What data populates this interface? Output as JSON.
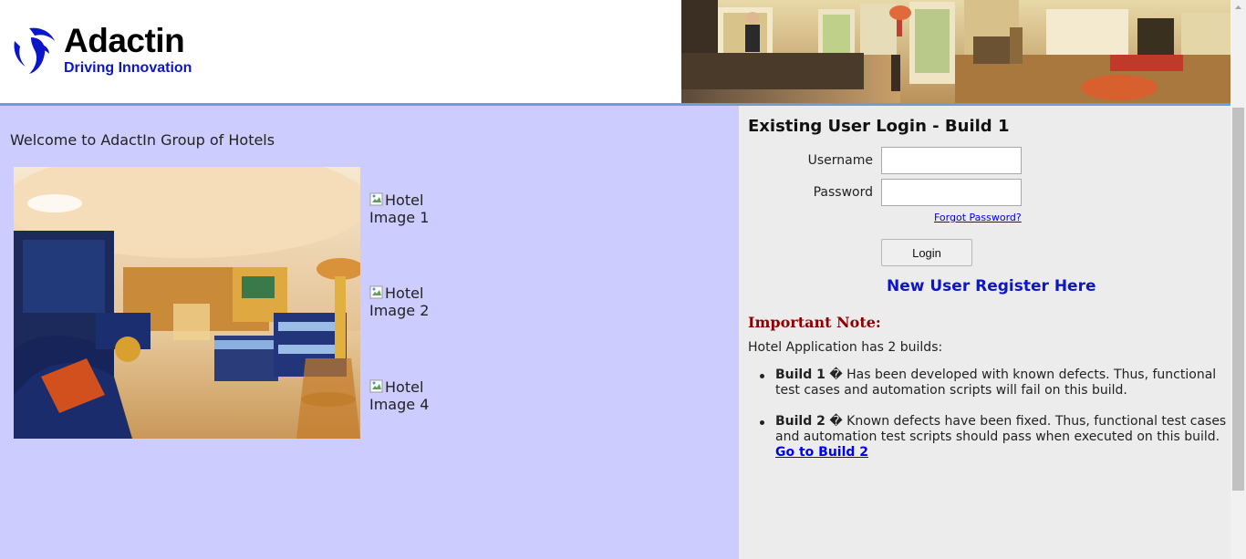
{
  "header": {
    "logo_name": "Adactin",
    "logo_tagline": "Driving Innovation"
  },
  "welcome": {
    "text": "Welcome to AdactIn Group of Hotels"
  },
  "hotel_images": [
    {
      "label": "Hotel Image 1"
    },
    {
      "label": "Hotel Image 2"
    },
    {
      "label": "Hotel Image 4"
    }
  ],
  "login": {
    "title": "Existing User Login - Build 1",
    "username_label": "Username",
    "username_value": "",
    "password_label": "Password",
    "password_value": "",
    "forgot_password": "Forgot Password?",
    "login_button": "Login",
    "register_link": "New User Register Here"
  },
  "note": {
    "title": "Important Note:",
    "intro": "Hotel Application has 2 builds:",
    "builds": [
      {
        "name": "Build 1",
        "separator": " � ",
        "description": "Has been developed with known defects. Thus, functional test cases and automation scripts will fail on this build."
      },
      {
        "name": "Build 2",
        "separator": " � ",
        "description": "Known defects have been fixed. Thus, functional test cases and automation test scripts should pass when executed on this build.",
        "link": "Go to Build 2"
      }
    ]
  },
  "colors": {
    "left_panel": "#ccccfe",
    "right_panel": "#ececec",
    "brand_blue": "#0d15c9",
    "note_title": "#8b0000",
    "header_rule": "#6d9dd1"
  }
}
